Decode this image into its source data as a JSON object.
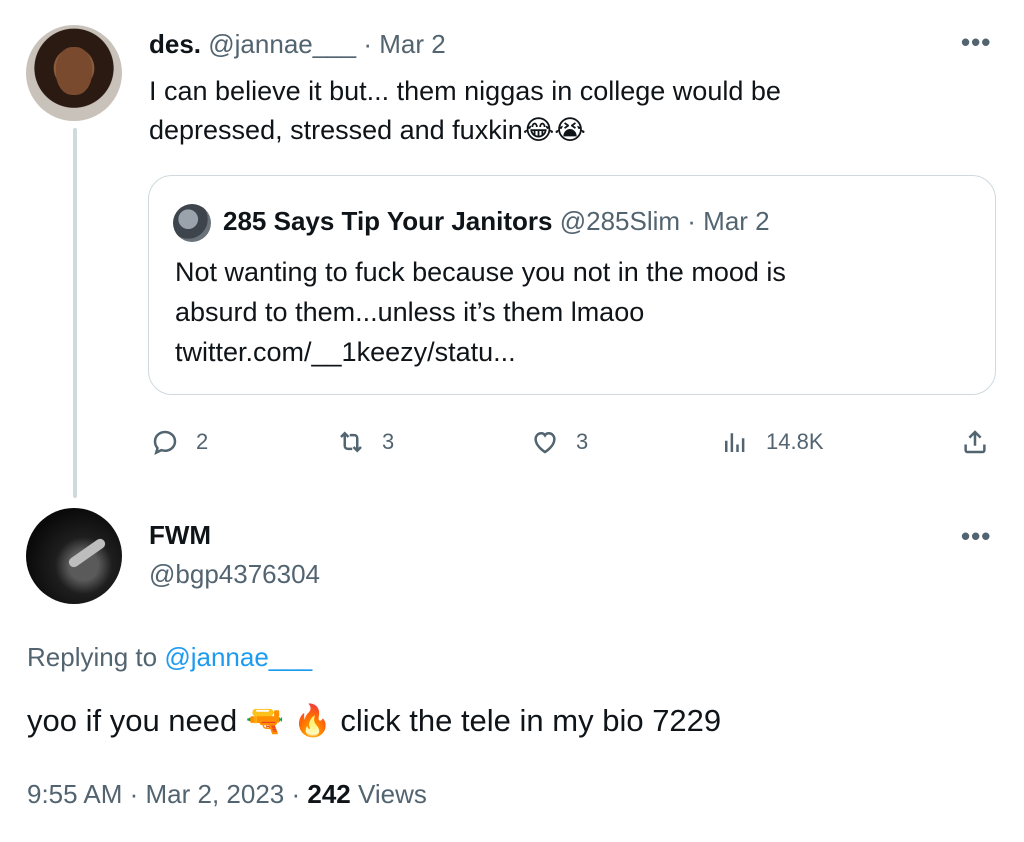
{
  "tweet1": {
    "display_name": "des.",
    "handle": "@jannae___",
    "date_sep": " · ",
    "date": "Mar 2",
    "more": "•••",
    "text_line1": "I can believe it but... them niggas in college would be",
    "text_line2": "depressed, stressed and fuxkin",
    "emojis": "😂😭",
    "quote": {
      "display_name": "285 Says Tip Your Janitors",
      "handle": "@285Slim",
      "date_sep": " · ",
      "date": "Mar 2",
      "text_line1": "Not wanting to fuck because you not in the mood is",
      "text_line2": "absurd to them...unless it’s them lmaoo",
      "text_line3": "twitter.com/__1keezy/statu..."
    },
    "actions": {
      "replies": "2",
      "retweets": "3",
      "likes": "3",
      "views": "14.8K"
    }
  },
  "tweet2": {
    "display_name": "FWM",
    "handle": "@bgp4376304",
    "more": "•••",
    "replying_prefix": "Replying to ",
    "replying_handle": "@jannae___",
    "text_part1": "yoo if you need ",
    "emoji1": "🔫",
    "emoji2": "🔥",
    "text_part2": " click the tele in my bio 7229",
    "time": "9:55 AM",
    "sep": " · ",
    "date": "Mar 2, 2023",
    "sep2": " · ",
    "views_count": "242",
    "views_label": " Views"
  },
  "colors": {
    "text": "#0f1419",
    "muted": "#536471",
    "link": "#1d9bf0",
    "border": "#cfd9de"
  }
}
